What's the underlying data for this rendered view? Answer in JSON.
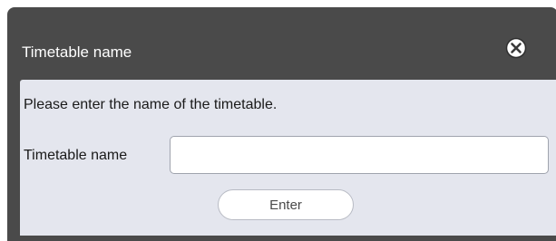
{
  "dialog": {
    "title": "Timetable name",
    "close_icon": "close-circle-icon",
    "prompt": "Please enter the name of the timetable.",
    "field_label": "Timetable name",
    "field_value": "",
    "enter_label": "Enter"
  },
  "colors": {
    "title_bar": "#4a4a4a",
    "content_bg": "#e4e6ee",
    "button_bg": "#ffffff"
  }
}
